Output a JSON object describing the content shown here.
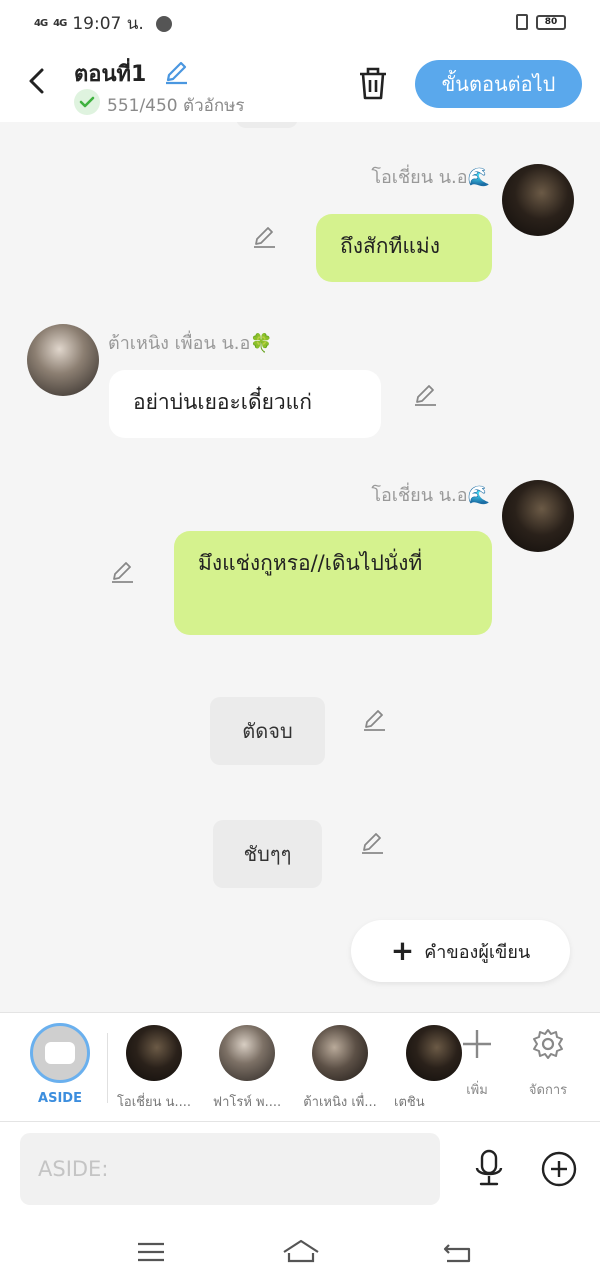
{
  "status_bar": {
    "network_1": "4G",
    "network_2": "4G",
    "time": "19:07 น.",
    "battery": "80",
    "icons": [
      "signal-icon",
      "messenger-icon",
      "vibrate-icon",
      "battery-icon"
    ]
  },
  "header": {
    "title": "ตอนที่1",
    "char_count": "551/450 ตัวอักษร",
    "next_button": "ขั้นตอนต่อไป",
    "accent": "#5aa8ec"
  },
  "messages": [
    {
      "side": "right",
      "sender": "โอเชี่ยน น.อ🌊",
      "text": "ถึงสักทีแม่ง",
      "style": "green"
    },
    {
      "side": "left",
      "sender": "ต้าเหนิง เพื่อน น.อ🍀",
      "text": "อย่าบ่นเยอะเดี๋ยวแก่",
      "style": "white"
    },
    {
      "side": "right",
      "sender": "โอเชี่ยน น.อ🌊",
      "text": "มึงแช่งกูหรอ//เดินไปนั่งที่",
      "style": "green"
    }
  ],
  "narrations": [
    {
      "text": "ตัดจบ"
    },
    {
      "text": "ชับๆๆ"
    }
  ],
  "author_note_button": "คำของผู้เขียน",
  "character_bar": {
    "aside_label": "ASIDE",
    "characters": [
      {
        "label": "โอเชี่ยน น...."
      },
      {
        "label": "ฟาโรห์ พ...."
      },
      {
        "label": "ต้าเหนิง เพื่..."
      },
      {
        "label": "เตชิน"
      }
    ],
    "add_label": "เพิ่ม",
    "manage_label": "จัดการ"
  },
  "input": {
    "placeholder": "ASIDE:",
    "value": ""
  },
  "colors": {
    "bubble_green": "#d5f28e",
    "bubble_white": "#ffffff",
    "background": "#f5f5f5"
  }
}
